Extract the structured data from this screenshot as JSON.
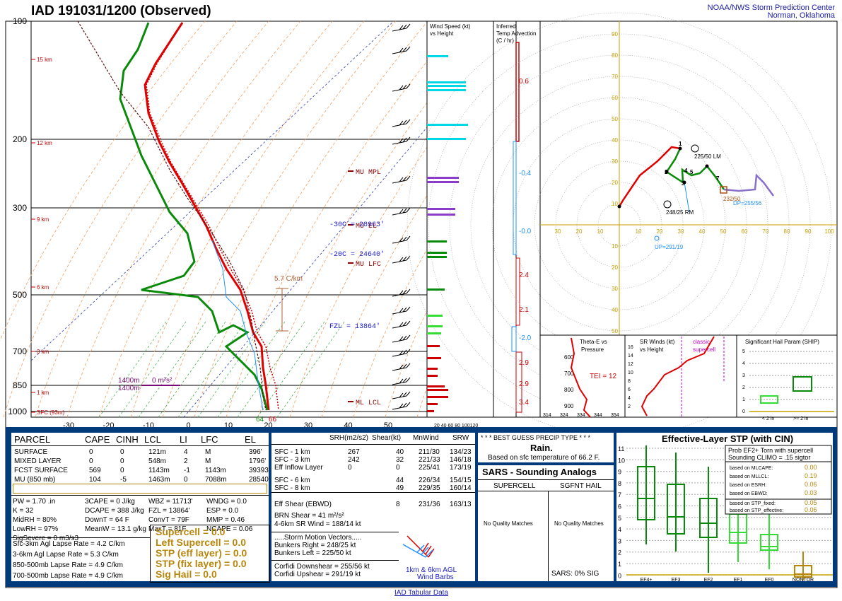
{
  "header": {
    "title": "IAD   191031/1200  (Observed)",
    "center_line1": "NOAA/NWS Storm Prediction Center",
    "center_line2": "Norman, Oklahoma"
  },
  "skewt": {
    "pressure_labels": [
      "100",
      "200",
      "300",
      "500",
      "700",
      "850",
      "1000"
    ],
    "height_labels": [
      "15 km",
      "12 km",
      "9 km",
      "6 km",
      "3 km",
      "1 km",
      "SFC (93m)"
    ],
    "temp_labels": [
      "-30",
      "-20",
      "-10",
      "0",
      "10",
      "20",
      "30",
      "40",
      "50"
    ],
    "annotations": {
      "mu_mpl": "MU MPL",
      "mu_el": "MU EL",
      "mu_lfc": "MU LFC",
      "ml_lcl": "ML LCL",
      "minus30": "-30C = 28963'",
      "minus20": "-20C = 24640'",
      "fzl": "FZL = 13864'",
      "lapse": "5.7 C/km",
      "h1400a": "1400m",
      "h1400b": "1400m",
      "zero_m": "0 m²s²",
      "sfc_t": "64",
      "sfc_td": "66"
    }
  },
  "wind_speed_panel": {
    "title1": "Wind Speed (kt)",
    "title2": "vs Height",
    "xaxis": "20 40 60 80 100120"
  },
  "temp_adv_panel": {
    "title1": "Inferred",
    "title2": "Temp Advection",
    "title3": "(C / hr)",
    "values": [
      "0.6",
      "-0.4",
      "-0.0",
      "2.4",
      "2.1",
      "-2.0",
      "2.9",
      "2.9",
      "3.4"
    ]
  },
  "hodograph": {
    "rings_x": [
      "30",
      "20",
      "10",
      "10",
      "20",
      "30",
      "40",
      "50",
      "60",
      "70",
      "80",
      "90",
      "100"
    ],
    "rings_y_up": [
      "90",
      "80",
      "70",
      "60",
      "50",
      "40",
      "30",
      "20",
      "10"
    ],
    "rings_y_down": [
      "10",
      "20",
      "30",
      "40",
      "50"
    ],
    "lm": "225/50 LM",
    "rm": "248/25 RM",
    "dp": "DP=255/56",
    "up": "UP=291/19",
    "mean": "232/50",
    "pts": [
      "1",
      "2",
      "3",
      "4",
      "5",
      "7"
    ]
  },
  "theta_panel": {
    "title1": "Theta-E vs",
    "title2": "Pressure",
    "tei": "TEI = 12",
    "plabels": [
      "600",
      "700",
      "800",
      "900"
    ],
    "xlabels": [
      "314",
      "324",
      "334",
      "344",
      "354"
    ]
  },
  "srw_panel": {
    "title1": "SR Winds (kt)",
    "title2": "vs Height",
    "classic": "classic",
    "supercell": "supercell",
    "ylabels": [
      "16",
      "14",
      "12",
      "10",
      "8",
      "6",
      "4",
      "2"
    ]
  },
  "ship_panel": {
    "title": "Significant Hail Param (SHIP)",
    "ylabels": [
      "5",
      "4",
      "3",
      "2",
      "1",
      "0"
    ],
    "xlabels": [
      "< 2 in",
      ">= 2 in"
    ]
  },
  "parcel_table": {
    "headers": [
      "PARCEL",
      "CAPE",
      "CINH",
      "LCL",
      "LI",
      "LFC",
      "EL"
    ],
    "rows": [
      [
        "SURFACE",
        "0",
        "0",
        "121m",
        "4",
        "M",
        "396'"
      ],
      [
        "MIXED LAYER",
        "0",
        "0",
        "548m",
        "2",
        "M",
        "1796'"
      ],
      [
        "FCST SURFACE",
        "569",
        "0",
        "1143m",
        "-1",
        "1143m",
        "39393'"
      ],
      [
        "MU  (850 mb)",
        "104",
        "-5",
        "1463m",
        "0",
        "7088m",
        "28540'"
      ]
    ],
    "params_col1": [
      "PW = 1.70 .in",
      "K = 32",
      "MidRH = 80%",
      "LowRH = 97%",
      "SigSevere = 0 m3/s3"
    ],
    "params_col2": [
      "3CAPE = 0 J/kg",
      "DCAPE = 388 J/kg",
      "DownT = 64 F",
      "MeanW = 13.1 g/kg"
    ],
    "params_col3": [
      "WBZ = 11713'",
      "FZL = 13864'",
      "ConvT = 79F",
      "MaxT = 81F"
    ],
    "params_col4": [
      "WNDG = 0.0",
      "ESP = 0.0",
      "MMP = 0.46",
      "NCAPE = 0.06"
    ],
    "lapse_rates": [
      "Sfc-3km Agl Lapse Rate = 4.2 C/km",
      "3-6km Agl Lapse Rate =   5.3 C/km",
      "850-500mb Lapse Rate =  4.9 C/km",
      "700-500mb Lapse Rate =  4.9 C/km"
    ],
    "composites": [
      "Supercell = 0.0",
      "Left Supercell = 0.0",
      "STP (eff layer) = 0.0",
      "STP (fix layer) = 0.0",
      "Sig Hail = 0.0"
    ]
  },
  "kinematics": {
    "headers": [
      "SRH(m2/s2)",
      "Shear(kt)",
      "MnWind",
      "SRW"
    ],
    "rows": [
      [
        "SFC - 1 km",
        "267",
        "40",
        "211/30",
        "134/23"
      ],
      [
        "SFC - 3 km",
        "242",
        "32",
        "221/33",
        "146/18"
      ],
      [
        "Eff Inflow Layer",
        "0",
        "0",
        "225/41",
        "173/19"
      ],
      [
        "SFC - 6 km",
        "",
        "44",
        "226/34",
        "154/15"
      ],
      [
        "SFC - 8 km",
        "",
        "49",
        "229/35",
        "160/14"
      ],
      [
        "Eff Shear (EBWD)",
        "",
        "8",
        "231/36",
        "163/13"
      ]
    ],
    "brn": "BRN Shear = 41 m²/s²",
    "srwind46": "4-6km SR Wind =        188/14 kt",
    "storm_vectors": ".....Storm Motion Vectors.....",
    "bunkers_r": "Bunkers Right =           248/25 kt",
    "bunkers_l": "Bunkers Left =             225/50 kt",
    "corfidi_down": "Corfidi Downshear =   255/56 kt",
    "corfidi_up": "Corfidi Upshear =       291/19 kt",
    "barb_label1": "1km & 6km AGL",
    "barb_label2": "Wind Barbs"
  },
  "precip": {
    "title": "* * * BEST GUESS PRECIP TYPE * * *",
    "value": "Rain.",
    "note": "Based on sfc temperature of 66.2 F."
  },
  "sars": {
    "title": "SARS - Sounding Analogs",
    "col1": "SUPERCELL",
    "col2": "SGFNT HAIL",
    "nomatch1": "No Quality Matches",
    "nomatch2": "No Quality Matches",
    "footer": "SARS:  0% SIG"
  },
  "stp_panel": {
    "title": "Effective-Layer STP (with CIN)",
    "prob1": "Prob EF2+ Torn with supercell",
    "prob2": "Sounding CLIMO = .15 sigtor",
    "rows": [
      [
        "based on MLCAPE:",
        "0.00"
      ],
      [
        "based on MLLCL:",
        "0.19"
      ],
      [
        "based on ESRH:",
        "0.06"
      ],
      [
        "based on EBWD:",
        "0.03"
      ],
      [
        "based on STP_fixed:",
        "0.05"
      ],
      [
        "based on STP_effective:",
        "0.06"
      ]
    ],
    "ylabels": [
      "11",
      "10",
      "9",
      "8",
      "7",
      "6",
      "5",
      "4",
      "3",
      "2",
      "1",
      "0"
    ],
    "xlabels": [
      "EF4+",
      "EF3",
      "EF2",
      "EF1",
      "EF0",
      "NONTOR"
    ]
  },
  "footer_link": "IAD Tabular Data",
  "colors": {
    "temp": "#e00000",
    "dewpoint": "#0a8a0a",
    "virtual": "#cc0000",
    "mixing_ratio": "#4caf50",
    "dry_adiabat": "#f0a060",
    "navy": "#003a7a",
    "cyan": "#00d8e8",
    "purple": "#8a3cc8",
    "gold": "#b8860b"
  }
}
